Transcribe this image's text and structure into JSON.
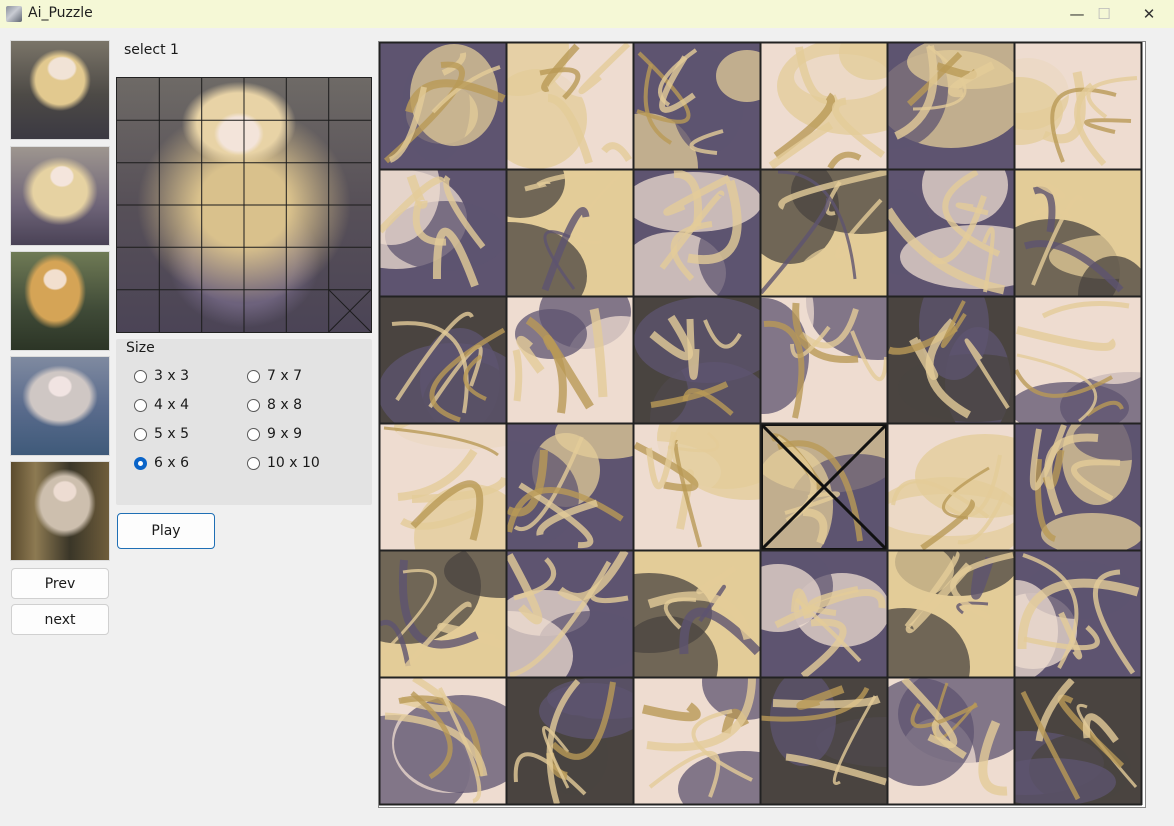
{
  "window": {
    "title": "Ai_Puzzle",
    "minimize_glyph": "—",
    "maximize_glyph": "☐",
    "close_glyph": "✕"
  },
  "sidebar": {
    "thumbnails": [
      {
        "icon": "thumbnail-1"
      },
      {
        "icon": "thumbnail-2"
      },
      {
        "icon": "thumbnail-3"
      },
      {
        "icon": "thumbnail-4"
      },
      {
        "icon": "thumbnail-5"
      }
    ],
    "prev_label": "Prev",
    "next_label": "next"
  },
  "main": {
    "select_label": "select 1",
    "size": {
      "legend": "Size",
      "options": [
        "3 x 3",
        "4 x 4",
        "5 x 5",
        "6 x 6",
        "7 x 7",
        "8 x 8",
        "9 x 9",
        "10 x 10"
      ],
      "selected": "6 x 6"
    },
    "play_label": "Play"
  },
  "board": {
    "rows": 6,
    "cols": 6,
    "empty_tile": {
      "row": 4,
      "col": 4
    },
    "colors": {
      "hair": "#e3cc98",
      "dress": "#5e5470",
      "skin": "#eedcd0",
      "gold": "#b99a56",
      "background": "#4a4440",
      "frame": "#222222",
      "accent": "#0a64c8"
    }
  }
}
